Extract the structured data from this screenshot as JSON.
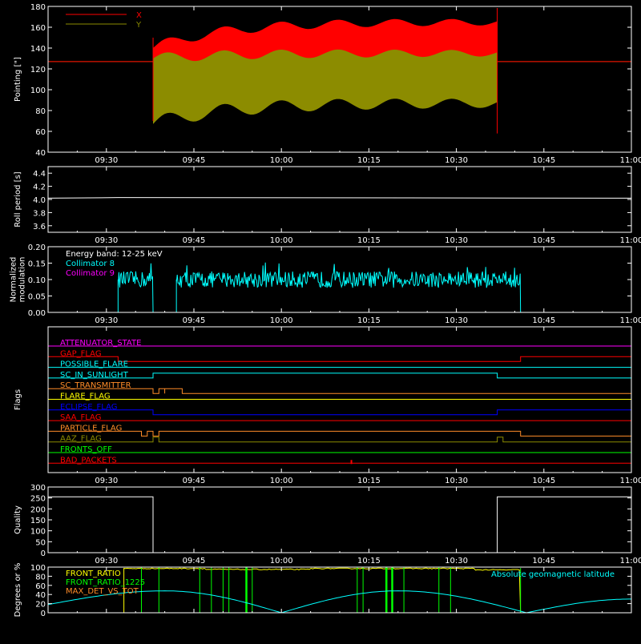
{
  "colors": {
    "background": "#000000",
    "axes": "#ffffff",
    "red": "#ff0000",
    "olive": "#8c8c00",
    "white": "#ffffff",
    "cyan": "#00ffff",
    "magenta": "#ff00ff",
    "yellow": "#ffff00",
    "green": "#00ff00",
    "orange": "#ff8c28",
    "blue": "#0000ff"
  },
  "chart_data": [
    {
      "type": "area",
      "ylabel": "Pointing [\"]",
      "x_ticks": [
        "09:30",
        "09:45",
        "10:00",
        "10:15",
        "10:30",
        "10:45",
        "11:00"
      ],
      "y_ticks": [
        40,
        60,
        80,
        100,
        120,
        140,
        160,
        180
      ],
      "xlim": [
        "09:20",
        "11:00"
      ],
      "ylim": [
        40,
        180
      ],
      "legend_placement": "top-left",
      "series": [
        {
          "name": "X",
          "color": "#ff0000",
          "t_start": "09:38",
          "t_end": "10:37",
          "upper_start": 140,
          "upper_end": 165,
          "lower_start": 75,
          "lower_end": 135,
          "baseline": 127
        },
        {
          "name": "Y",
          "color": "#8c8c00",
          "t_start": "09:38",
          "t_end": "10:37",
          "upper_start": 130,
          "upper_end": 135,
          "lower_start": 70,
          "lower_end": 90,
          "baseline": 127
        }
      ]
    },
    {
      "type": "line",
      "ylabel": "Roll period [s]",
      "x_ticks": [
        "09:30",
        "09:45",
        "10:00",
        "10:15",
        "10:30",
        "10:45",
        "11:00"
      ],
      "y_ticks": [
        "3.6",
        "3.8",
        "4.0",
        "4.2",
        "4.4"
      ],
      "ylim": [
        3.5,
        4.5
      ],
      "series": [
        {
          "color": "#ffffff",
          "value": 4.02
        }
      ]
    },
    {
      "type": "line",
      "ylabel_lines": [
        "Normalized",
        "modulation"
      ],
      "x_ticks": [
        "09:30",
        "09:45",
        "10:00",
        "10:15",
        "10:30",
        "10:45",
        "11:00"
      ],
      "y_ticks": [
        "0.00",
        "0.05",
        "0.10",
        "0.15",
        "0.20"
      ],
      "ylim": [
        0,
        0.2
      ],
      "annotation": "Energy band: 12-25 keV",
      "series": [
        {
          "name": "Collimator 8",
          "color": "#00ffff",
          "segments": [
            [
              "09:32",
              "09:38"
            ],
            [
              "09:42",
              "10:41"
            ]
          ],
          "mean": 0.1
        },
        {
          "name": "Collimator 9",
          "color": "#ff00ff",
          "value": 0.0
        }
      ]
    },
    {
      "type": "line",
      "ylabel": "Flags",
      "x_ticks": [
        "09:30",
        "09:45",
        "10:00",
        "10:15",
        "10:30",
        "10:45",
        "11:00"
      ],
      "flags": [
        {
          "name": "ATTENUATOR_STATE",
          "color": "#ff00ff"
        },
        {
          "name": "GAP_FLAG",
          "color": "#ff0000"
        },
        {
          "name": "POSSIBLE_FLARE",
          "color": "#00ffff"
        },
        {
          "name": "SC_IN_SUNLIGHT",
          "color": "#00ffff"
        },
        {
          "name": "SC_TRANSMITTER",
          "color": "#ff8c28"
        },
        {
          "name": "FLARE_FLAG",
          "color": "#ffff00"
        },
        {
          "name": "ECLIPSE_FLAG",
          "color": "#0000ff"
        },
        {
          "name": "SAA_FLAG",
          "color": "#ff0000"
        },
        {
          "name": "PARTICLE_FLAG",
          "color": "#ff8c28"
        },
        {
          "name": "AAZ_FLAG",
          "color": "#8c8c00"
        },
        {
          "name": "FRONTS_OFF",
          "color": "#00ff00"
        },
        {
          "name": "BAD_PACKETS",
          "color": "#ff0000"
        }
      ]
    },
    {
      "type": "line",
      "ylabel": "Quality",
      "x_ticks": [
        "09:30",
        "09:45",
        "10:00",
        "10:15",
        "10:30",
        "10:45",
        "11:00"
      ],
      "y_ticks": [
        0,
        50,
        100,
        150,
        200,
        250,
        300
      ],
      "ylim": [
        0,
        300
      ],
      "series": [
        {
          "color": "#ffffff",
          "steps": [
            [
              "09:20",
              255
            ],
            [
              "09:38",
              0
            ],
            [
              "10:37",
              255
            ],
            [
              "11:00",
              255
            ]
          ]
        }
      ]
    },
    {
      "type": "line",
      "ylabel": "Degrees or %",
      "x_ticks": [
        "09:30",
        "09:45",
        "10:00",
        "10:15",
        "10:30",
        "10:45",
        "11:00"
      ],
      "y_ticks": [
        0,
        20,
        40,
        60,
        80,
        100
      ],
      "ylim": [
        0,
        100
      ],
      "series": [
        {
          "name": "FRONT_RATIO",
          "color": "#ffff00",
          "level": 97
        },
        {
          "name": "FRONT_RATIO_1225",
          "color": "#00ff00"
        },
        {
          "name": "MAX_DET_VS_TOT",
          "color": "#ff8c28"
        },
        {
          "name": "Absolute geomagnetic latitude",
          "color": "#00ffff",
          "peaks": [
            [
              "09:40",
              48
            ],
            [
              "10:20",
              48
            ]
          ],
          "troughs": [
            [
              "10:00",
              0
            ],
            [
              "10:42",
              0
            ]
          ]
        }
      ]
    }
  ]
}
